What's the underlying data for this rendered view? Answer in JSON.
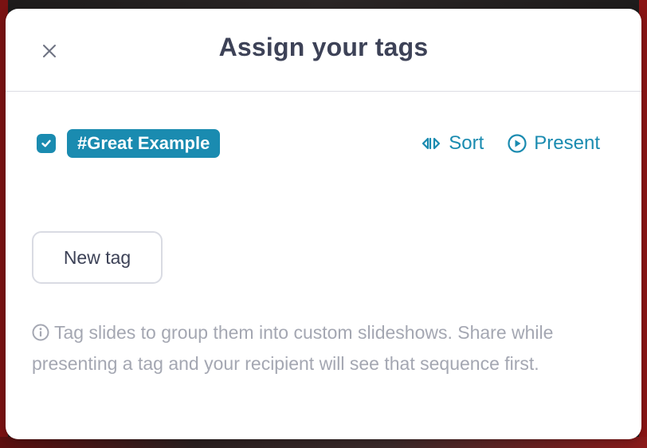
{
  "modal": {
    "title": "Assign your tags",
    "close_icon": "close-icon"
  },
  "tags": [
    {
      "label": "#Great Example",
      "checked": true
    }
  ],
  "actions": {
    "sort_label": "Sort",
    "sort_icon": "sort-arrows-icon",
    "present_label": "Present",
    "present_icon": "play-circle-icon"
  },
  "new_tag_label": "New tag",
  "info": {
    "icon": "info-circle-icon",
    "text": "Tag slides to group them into custom slideshows. Share while presenting a tag and your recipient will see that sequence first."
  },
  "colors": {
    "accent": "#1a8bb0",
    "title": "#3d4257",
    "muted": "#a4a7b2",
    "border": "#d9dbe3"
  }
}
